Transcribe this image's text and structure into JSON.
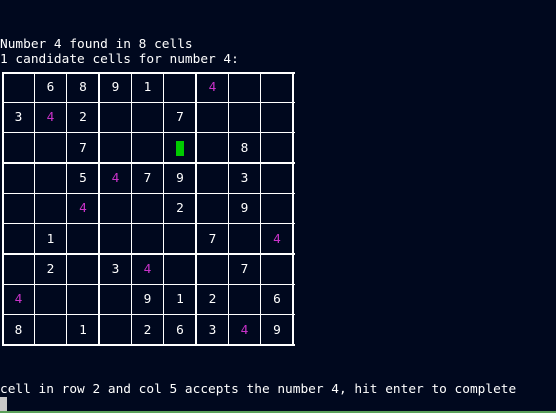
{
  "messages": {
    "found": "Number 4 found in 8 cells",
    "candidates": "1 candidate cells for number 4:",
    "prompt": "cell in row 2 and col 5 accepts the number 4, hit enter to complete"
  },
  "highlight_number": "4",
  "candidate_cell": {
    "row": 2,
    "col": 5
  },
  "colors": {
    "background": "#00081e",
    "text": "#ffffff",
    "highlight": "#c832c8",
    "candidate": "#00cc00"
  },
  "board": [
    [
      "",
      "6",
      "8",
      "9",
      "1",
      "",
      "4",
      "",
      ""
    ],
    [
      "3",
      "4",
      "2",
      "",
      "",
      "7",
      "",
      "",
      ""
    ],
    [
      "",
      "",
      "7",
      "",
      "",
      "",
      "",
      "8",
      ""
    ],
    [
      "",
      "",
      "5",
      "4",
      "7",
      "9",
      "",
      "3",
      ""
    ],
    [
      "",
      "",
      "4",
      "",
      "",
      "2",
      "",
      "9",
      ""
    ],
    [
      "",
      "1",
      "",
      "",
      "",
      "",
      "7",
      "",
      "4"
    ],
    [
      "",
      "2",
      "",
      "3",
      "4",
      "",
      "",
      "7",
      ""
    ],
    [
      "4",
      "",
      "",
      "",
      "9",
      "1",
      "2",
      "",
      "6"
    ],
    [
      "8",
      "",
      "1",
      "",
      "2",
      "6",
      "3",
      "4",
      "9"
    ]
  ]
}
